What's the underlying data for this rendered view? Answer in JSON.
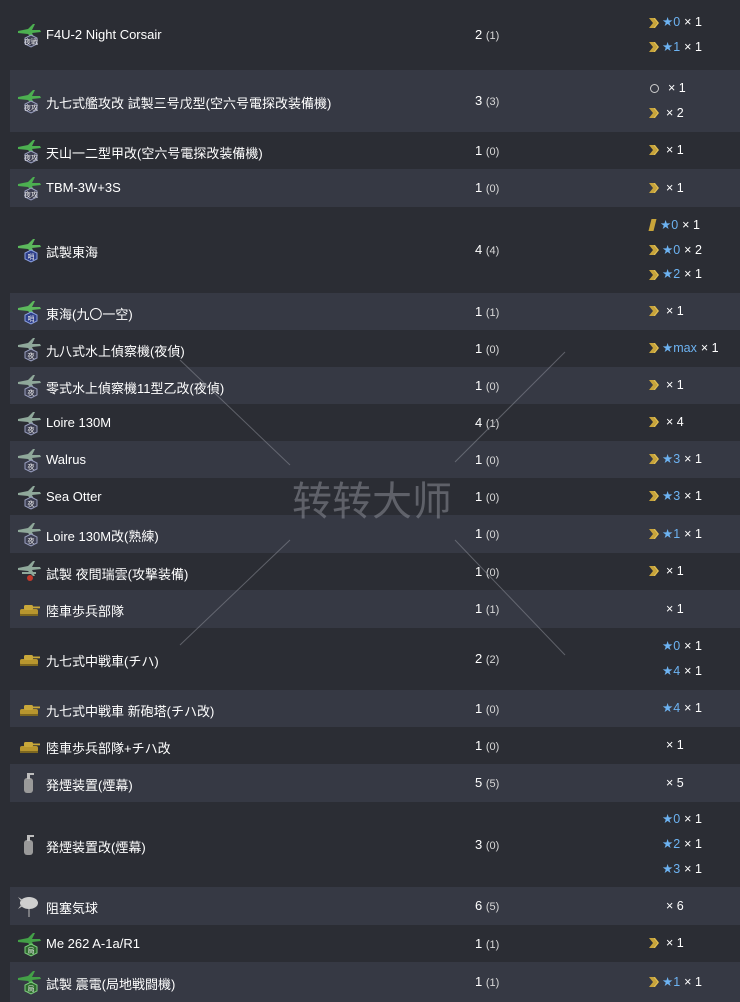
{
  "rows": [
    {
      "icon": "night-fighter-icon",
      "name": "F4U-2 Night Corsair",
      "count": "2",
      "sub": "(1)",
      "prof": [
        {
          "mark": "chevron",
          "stars": "★0",
          "mult": "× 1"
        },
        {
          "mark": "chevron",
          "stars": "★1",
          "mult": "× 1"
        }
      ]
    },
    {
      "icon": "night-attacker-icon",
      "name": "九七式艦攻改 試製三号戊型(空六号電探改装備機)",
      "count": "3",
      "sub": "(3)",
      "prof": [
        {
          "mark": "ring",
          "stars": "",
          "mult": "× 1"
        },
        {
          "mark": "chevron",
          "stars": "",
          "mult": "× 2"
        }
      ]
    },
    {
      "icon": "night-attacker-icon",
      "name": "天山一二型甲改(空六号電探改装備機)",
      "count": "1",
      "sub": "(0)",
      "prof": [
        {
          "mark": "chevron",
          "stars": "",
          "mult": "× 1"
        }
      ]
    },
    {
      "icon": "night-attacker-icon",
      "name": "TBM-3W+3S",
      "count": "1",
      "sub": "(0)",
      "prof": [
        {
          "mark": "chevron",
          "stars": "",
          "mult": "× 1"
        }
      ]
    },
    {
      "icon": "patrol-plane-icon",
      "name": "試製東海",
      "count": "4",
      "sub": "(4)",
      "prof": [
        {
          "mark": "bar",
          "stars": "★0",
          "mult": "× 1"
        },
        {
          "mark": "chevron",
          "stars": "★0",
          "mult": "× 2"
        },
        {
          "mark": "chevron",
          "stars": "★2",
          "mult": "× 1"
        }
      ]
    },
    {
      "icon": "patrol-plane-icon",
      "name": "東海(九〇一空)",
      "count": "1",
      "sub": "(1)",
      "prof": [
        {
          "mark": "chevron",
          "stars": "",
          "mult": "× 1"
        }
      ]
    },
    {
      "icon": "night-seaplane-icon",
      "name": "九八式水上偵察機(夜偵)",
      "count": "1",
      "sub": "(0)",
      "prof": [
        {
          "mark": "chevron",
          "stars": "★max",
          "mult": "× 1"
        }
      ]
    },
    {
      "icon": "night-seaplane-icon",
      "name": "零式水上偵察機11型乙改(夜偵)",
      "count": "1",
      "sub": "(0)",
      "prof": [
        {
          "mark": "chevron",
          "stars": "",
          "mult": "× 1"
        }
      ]
    },
    {
      "icon": "night-seaplane-icon",
      "name": "Loire 130M",
      "count": "4",
      "sub": "(1)",
      "prof": [
        {
          "mark": "chevron",
          "stars": "",
          "mult": "× 4"
        }
      ]
    },
    {
      "icon": "night-seaplane-icon",
      "name": "Walrus",
      "count": "1",
      "sub": "(0)",
      "prof": [
        {
          "mark": "chevron",
          "stars": "★3",
          "mult": "× 1"
        }
      ]
    },
    {
      "icon": "night-seaplane-icon",
      "name": "Sea Otter",
      "count": "1",
      "sub": "(0)",
      "prof": [
        {
          "mark": "chevron",
          "stars": "★3",
          "mult": "× 1"
        }
      ]
    },
    {
      "icon": "night-seaplane-icon",
      "name": "Loire 130M改(熟練)",
      "count": "1",
      "sub": "(0)",
      "prof": [
        {
          "mark": "chevron",
          "stars": "★1",
          "mult": "× 1"
        }
      ]
    },
    {
      "icon": "night-attack-seaplane-icon",
      "name": "試製 夜間瑞雲(攻撃装備)",
      "count": "1",
      "sub": "(0)",
      "prof": [
        {
          "mark": "chevron",
          "stars": "",
          "mult": "× 1"
        }
      ]
    },
    {
      "icon": "tank-icon",
      "name": "陸車歩兵部隊",
      "count": "1",
      "sub": "(1)",
      "prof": [
        {
          "mark": "none",
          "stars": "",
          "mult": "× 1"
        }
      ]
    },
    {
      "icon": "tank-icon",
      "name": "九七式中戦車(チハ)",
      "count": "2",
      "sub": "(2)",
      "prof": [
        {
          "mark": "none",
          "stars": "★0",
          "mult": "× 1"
        },
        {
          "mark": "none",
          "stars": "★4",
          "mult": "× 1"
        }
      ]
    },
    {
      "icon": "tank-icon",
      "name": "九七式中戦車 新砲塔(チハ改)",
      "count": "1",
      "sub": "(0)",
      "prof": [
        {
          "mark": "none",
          "stars": "★4",
          "mult": "× 1"
        }
      ]
    },
    {
      "icon": "tank-icon",
      "name": "陸車歩兵部隊+チハ改",
      "count": "1",
      "sub": "(0)",
      "prof": [
        {
          "mark": "none",
          "stars": "",
          "mult": "× 1"
        }
      ]
    },
    {
      "icon": "smoke-generator-icon",
      "name": "発煙装置(煙幕)",
      "count": "5",
      "sub": "(5)",
      "prof": [
        {
          "mark": "none",
          "stars": "",
          "mult": "× 5"
        }
      ]
    },
    {
      "icon": "smoke-generator-icon",
      "name": "発煙装置改(煙幕)",
      "count": "3",
      "sub": "(0)",
      "prof": [
        {
          "mark": "none",
          "stars": "★0",
          "mult": "× 1"
        },
        {
          "mark": "none",
          "stars": "★2",
          "mult": "× 1"
        },
        {
          "mark": "none",
          "stars": "★3",
          "mult": "× 1"
        }
      ]
    },
    {
      "icon": "balloon-icon",
      "name": "阻塞気球",
      "count": "6",
      "sub": "(5)",
      "prof": [
        {
          "mark": "none",
          "stars": "",
          "mult": "× 6"
        }
      ]
    },
    {
      "icon": "land-fighter-icon",
      "name": "Me 262 A-1a/R1",
      "count": "1",
      "sub": "(1)",
      "prof": [
        {
          "mark": "chevron",
          "stars": "",
          "mult": "× 1"
        }
      ]
    },
    {
      "icon": "land-fighter-icon",
      "name": "試製 震電(局地戦闘機)",
      "count": "1",
      "sub": "(1)",
      "prof": [
        {
          "mark": "chevron",
          "stars": "★1",
          "mult": "× 1"
        }
      ]
    }
  ],
  "icon_badges": {
    "night-fighter-icon": "夜戦",
    "night-attacker-icon": "夜攻",
    "patrol-plane-icon": "哨",
    "night-seaplane-icon": "夜",
    "night-attack-seaplane-icon": "",
    "land-fighter-icon": "局"
  },
  "watermark": {
    "text": "转转大师"
  },
  "colors": {
    "row_odd": "#2b2d34",
    "row_even": "#363944",
    "star": "#6db3f2",
    "chevron": "#c8a43a"
  }
}
